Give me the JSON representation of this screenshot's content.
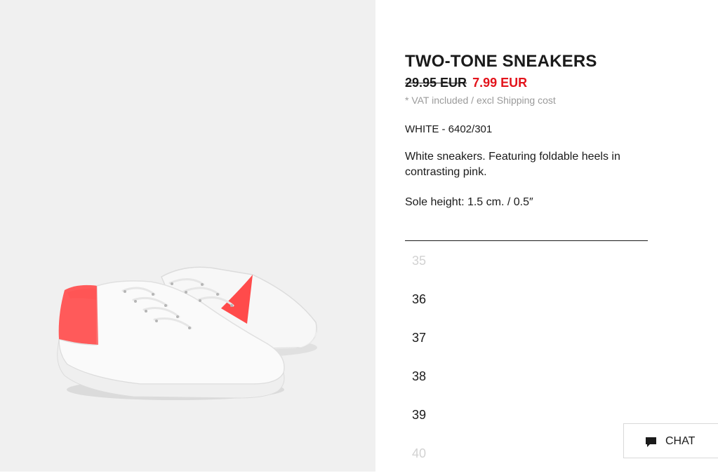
{
  "product": {
    "title": "TWO-TONE SNEAKERS",
    "old_price": "29.95 EUR",
    "sale_price": "7.99 EUR",
    "vat_note": "* VAT included / excl Shipping cost",
    "color_ref": "WHITE - 6402/301",
    "description": "White sneakers. Featuring foldable heels in contrasting pink.",
    "sole_height": "Sole height: 1.5 cm. / 0.5″",
    "image_alt_icon": "sneaker-image"
  },
  "sizes": [
    {
      "label": "35",
      "available": false
    },
    {
      "label": "36",
      "available": true
    },
    {
      "label": "37",
      "available": true
    },
    {
      "label": "38",
      "available": true
    },
    {
      "label": "39",
      "available": true
    },
    {
      "label": "40",
      "available": false
    }
  ],
  "chat": {
    "label": "CHAT",
    "icon": "chat-bubble-icon"
  },
  "colors": {
    "sale": "#e3141c",
    "text": "#1a1a1a",
    "muted": "#9a9a9a",
    "image_bg": "#f0f0f0",
    "heel_accent": "#ff4b4b"
  }
}
